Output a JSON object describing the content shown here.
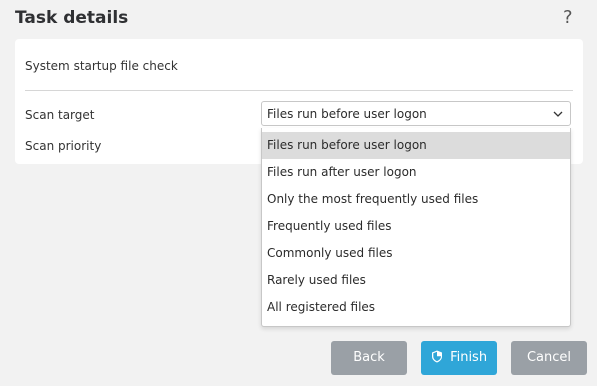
{
  "header": {
    "title": "Task details",
    "help": "?"
  },
  "card": {
    "task_name": "System startup file check",
    "scan_target_label": "Scan target",
    "scan_priority_label": "Scan priority",
    "scan_target_value": "Files run before user logon"
  },
  "dropdown": {
    "options": [
      "Files run before user logon",
      "Files run after user logon",
      "Only the most frequently used files",
      "Frequently used files",
      "Commonly used files",
      "Rarely used files",
      "All registered files"
    ],
    "selected_index": 0
  },
  "buttons": {
    "back": "Back",
    "finish": "Finish",
    "cancel": "Cancel"
  },
  "icons": {
    "help": "help-icon",
    "chevron": "chevron-down-icon",
    "shield": "shield-icon"
  },
  "colors": {
    "accent": "#2fa6d8",
    "secondary_button": "#9aa0a6",
    "selected_option": "#dcdcdc"
  }
}
